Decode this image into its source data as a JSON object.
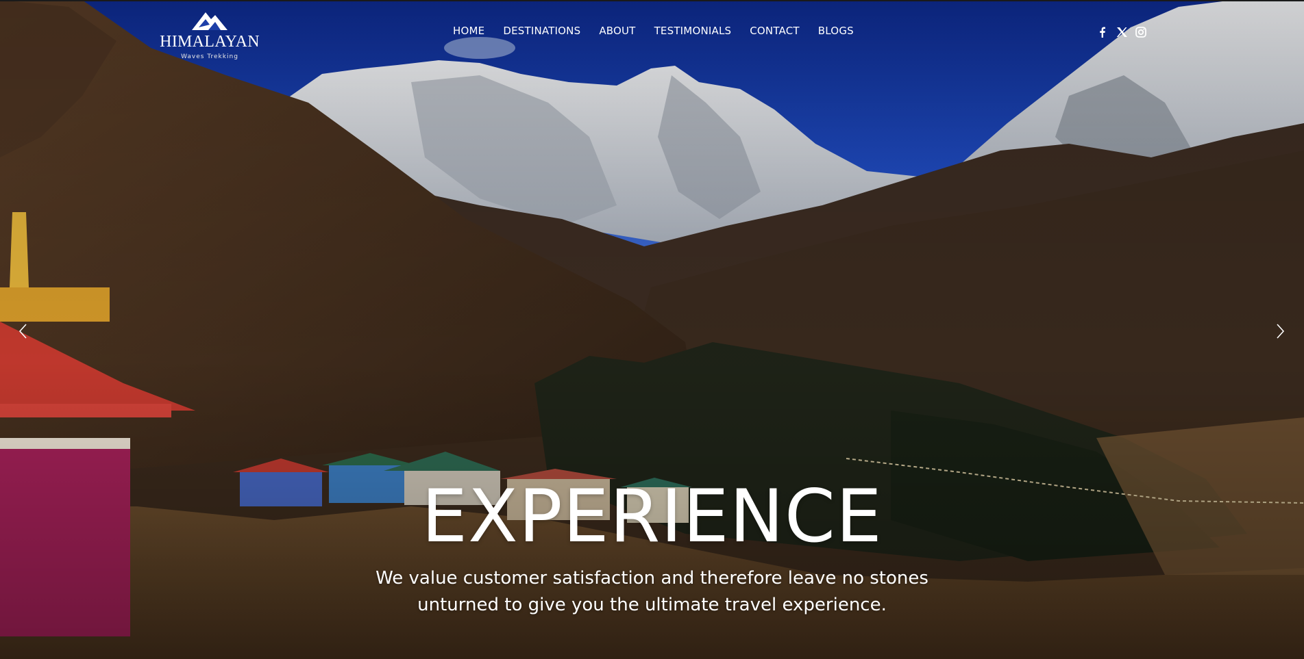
{
  "brand": {
    "name": "HIMALAYAN",
    "tagline": "Waves Trekking",
    "logo_icon": "mountain-logo-icon"
  },
  "nav": {
    "items": [
      "HOME",
      "DESTINATIONS",
      "ABOUT",
      "TESTIMONIALS",
      "CONTACT",
      "BLOGS"
    ]
  },
  "social": {
    "icons": [
      "facebook-icon",
      "x-icon",
      "instagram-icon"
    ]
  },
  "slider": {
    "prev_icon": "chevron-left-icon",
    "next_icon": "chevron-right-icon"
  },
  "hero": {
    "title": "EXPERIENCE",
    "subtitle": "We value customer satisfaction and therefore leave no stones unturned to give you the ultimate travel experience."
  },
  "colors": {
    "sky": "#1d3fa8",
    "snow": "#e9ecef",
    "valley": "#6b4a2c",
    "text": "#ffffff"
  }
}
